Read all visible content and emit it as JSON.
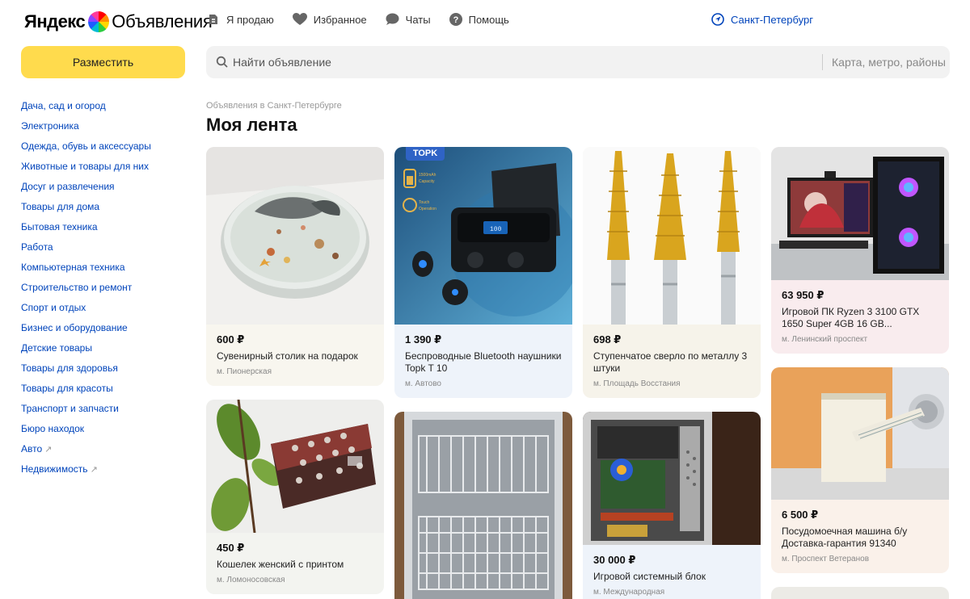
{
  "header": {
    "logo_brand": "Яндекс",
    "logo_product": "Объявления",
    "nav": [
      {
        "label": "Я продаю",
        "icon": "sell-icon"
      },
      {
        "label": "Избранное",
        "icon": "heart-icon"
      },
      {
        "label": "Чаты",
        "icon": "chat-icon"
      },
      {
        "label": "Помощь",
        "icon": "help-icon"
      }
    ],
    "city": "Санкт-Петербург"
  },
  "post_button": "Разместить",
  "search": {
    "placeholder": "Найти объявление",
    "location_placeholder": "Карта, метро, районы"
  },
  "sidebar": {
    "categories": [
      {
        "label": "Дача, сад и огород"
      },
      {
        "label": "Электроника"
      },
      {
        "label": "Одежда, обувь и аксессуары"
      },
      {
        "label": "Животные и товары для них"
      },
      {
        "label": "Досуг и развлечения"
      },
      {
        "label": "Товары для дома"
      },
      {
        "label": "Бытовая техника"
      },
      {
        "label": "Работа"
      },
      {
        "label": "Компьютерная техника"
      },
      {
        "label": "Строительство и ремонт"
      },
      {
        "label": "Спорт и отдых"
      },
      {
        "label": "Бизнес и оборудование"
      },
      {
        "label": "Детские товары"
      },
      {
        "label": "Товары для здоровья"
      },
      {
        "label": "Товары для красоты"
      },
      {
        "label": "Транспорт и запчасти"
      },
      {
        "label": "Бюро находок"
      },
      {
        "label": "Авто",
        "external": "↗"
      },
      {
        "label": "Недвижимость",
        "external": "↗"
      }
    ]
  },
  "breadcrumb": "Объявления в Санкт-Петербурге",
  "feed_title": "Моя лента",
  "colors": {
    "accent_yellow": "#ffdb4d",
    "link_blue": "#0044bb"
  },
  "cards": [
    {
      "price": "600 ₽",
      "name": "Сувенирный столик на подарок",
      "metro": "м. Пионерская"
    },
    {
      "price": "1 390 ₽",
      "name": "Беспроводные Bluetooth наушники Topk T 10",
      "metro": "м. Автово",
      "brand_badge": "TOPK",
      "img_text": [
        "1500mAh",
        "Capacity",
        "Touch",
        "Operation",
        "100"
      ]
    },
    {
      "price": "698 ₽",
      "name": "Ступенчатое сверло по металлу 3 штуки",
      "metro": "м. Площадь Восстания"
    },
    {
      "price": "63 950 ₽",
      "name": "Игровой ПК Ryzen 3 3100 GTX 1650 Super 4GB 16 GB...",
      "metro": "м. Ленинский проспект"
    },
    {
      "price": "450 ₽",
      "name": "Кошелек женский с принтом",
      "metro": "м. Ломоносовская"
    },
    {
      "price": "30 000 ₽",
      "name": "Игровой системный блок",
      "metro": "м. Международная"
    },
    {
      "price": "6 500 ₽",
      "name": "Посудомоечная машина б/у Доставка-гарантия 91340",
      "metro": "м. Проспект Ветеранов"
    }
  ]
}
